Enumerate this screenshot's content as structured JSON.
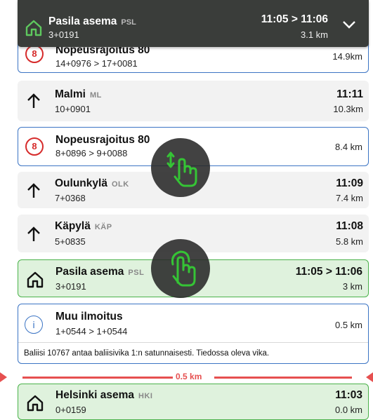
{
  "header": {
    "station": "Pasila asema",
    "code": "PSL",
    "position": "3+0191",
    "time": "11:05 > 11:06",
    "distance": "3.1 km",
    "icon": "home-icon",
    "expand_icon": "chevron-down-icon"
  },
  "rows": [
    {
      "kind": "speed",
      "value": "8",
      "title": "Nopeusrajoitus 80",
      "range": "14+0976 > 17+0081",
      "distance": "14.9km"
    },
    {
      "kind": "station",
      "title": "Malmi",
      "code": "ML",
      "position": "10+0901",
      "time": "11:11",
      "distance": "10.3km"
    },
    {
      "kind": "speed",
      "value": "8",
      "title": "Nopeusrajoitus 80",
      "range": "8+0896 > 9+0088",
      "distance": "8.4 km"
    },
    {
      "kind": "station",
      "title": "Oulunkylä",
      "code": "OLK",
      "position": "7+0368",
      "time": "11:09",
      "distance": "7.4 km"
    },
    {
      "kind": "station",
      "title": "Käpylä",
      "code": "KÄP",
      "position": "5+0835",
      "time": "11:08",
      "distance": "5.8 km"
    },
    {
      "kind": "current",
      "title": "Pasila asema",
      "code": "PSL",
      "position": "3+0191",
      "time": "11:05 > 11:06",
      "distance": "3 km"
    },
    {
      "kind": "info",
      "title": "Muu ilmoitus",
      "range": "1+0544 > 1+0544",
      "distance": "0.5 km",
      "note": "Baliisi 10767 antaa baliisivika 1:n satunnaisesti. Tiedossa oleva vika."
    },
    {
      "kind": "current",
      "title": "Helsinki asema",
      "code": "HKI",
      "position": "0+0159",
      "time": "11:03",
      "distance": "0.0 km"
    }
  ],
  "distance_marker": "0.5 km",
  "gestures": [
    "swipe-scroll-icon",
    "tap-icon"
  ],
  "colors": {
    "header": "#3a3d3a",
    "speed_red": "#d62b2b",
    "border_blue": "#3b74c4",
    "station_green": "#4ab24a",
    "station_bg": "#dff2dd",
    "marker_red": "#e65050"
  }
}
